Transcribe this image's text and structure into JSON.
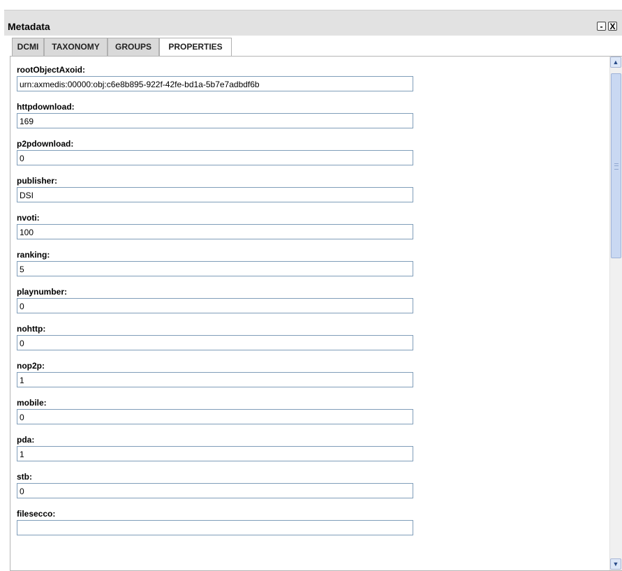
{
  "window": {
    "title": "Metadata",
    "minimize_label": "-",
    "close_label": "X"
  },
  "tabs": [
    {
      "label": "DCMI",
      "active": false
    },
    {
      "label": "TAXONOMY",
      "active": false
    },
    {
      "label": "GROUPS",
      "active": false
    },
    {
      "label": "PROPERTIES",
      "active": true
    }
  ],
  "fields": [
    {
      "label": "rootObjectAxoid:",
      "value": "urn:axmedis:00000:obj:c6e8b895-922f-42fe-bd1a-5b7e7adbdf6b"
    },
    {
      "label": "httpdownload:",
      "value": "169"
    },
    {
      "label": "p2pdownload:",
      "value": "0"
    },
    {
      "label": "publisher:",
      "value": "DSI"
    },
    {
      "label": "nvoti:",
      "value": "100"
    },
    {
      "label": "ranking:",
      "value": "5"
    },
    {
      "label": "playnumber:",
      "value": "0"
    },
    {
      "label": "nohttp:",
      "value": "0"
    },
    {
      "label": "nop2p:",
      "value": "1"
    },
    {
      "label": "mobile:",
      "value": "0"
    },
    {
      "label": "pda:",
      "value": "1"
    },
    {
      "label": "stb:",
      "value": "0"
    },
    {
      "label": "filesecco:",
      "value": ""
    }
  ],
  "scrollbar": {
    "up_icon": "scroll-up-arrow-icon",
    "down_icon": "scroll-down-arrow-icon"
  }
}
